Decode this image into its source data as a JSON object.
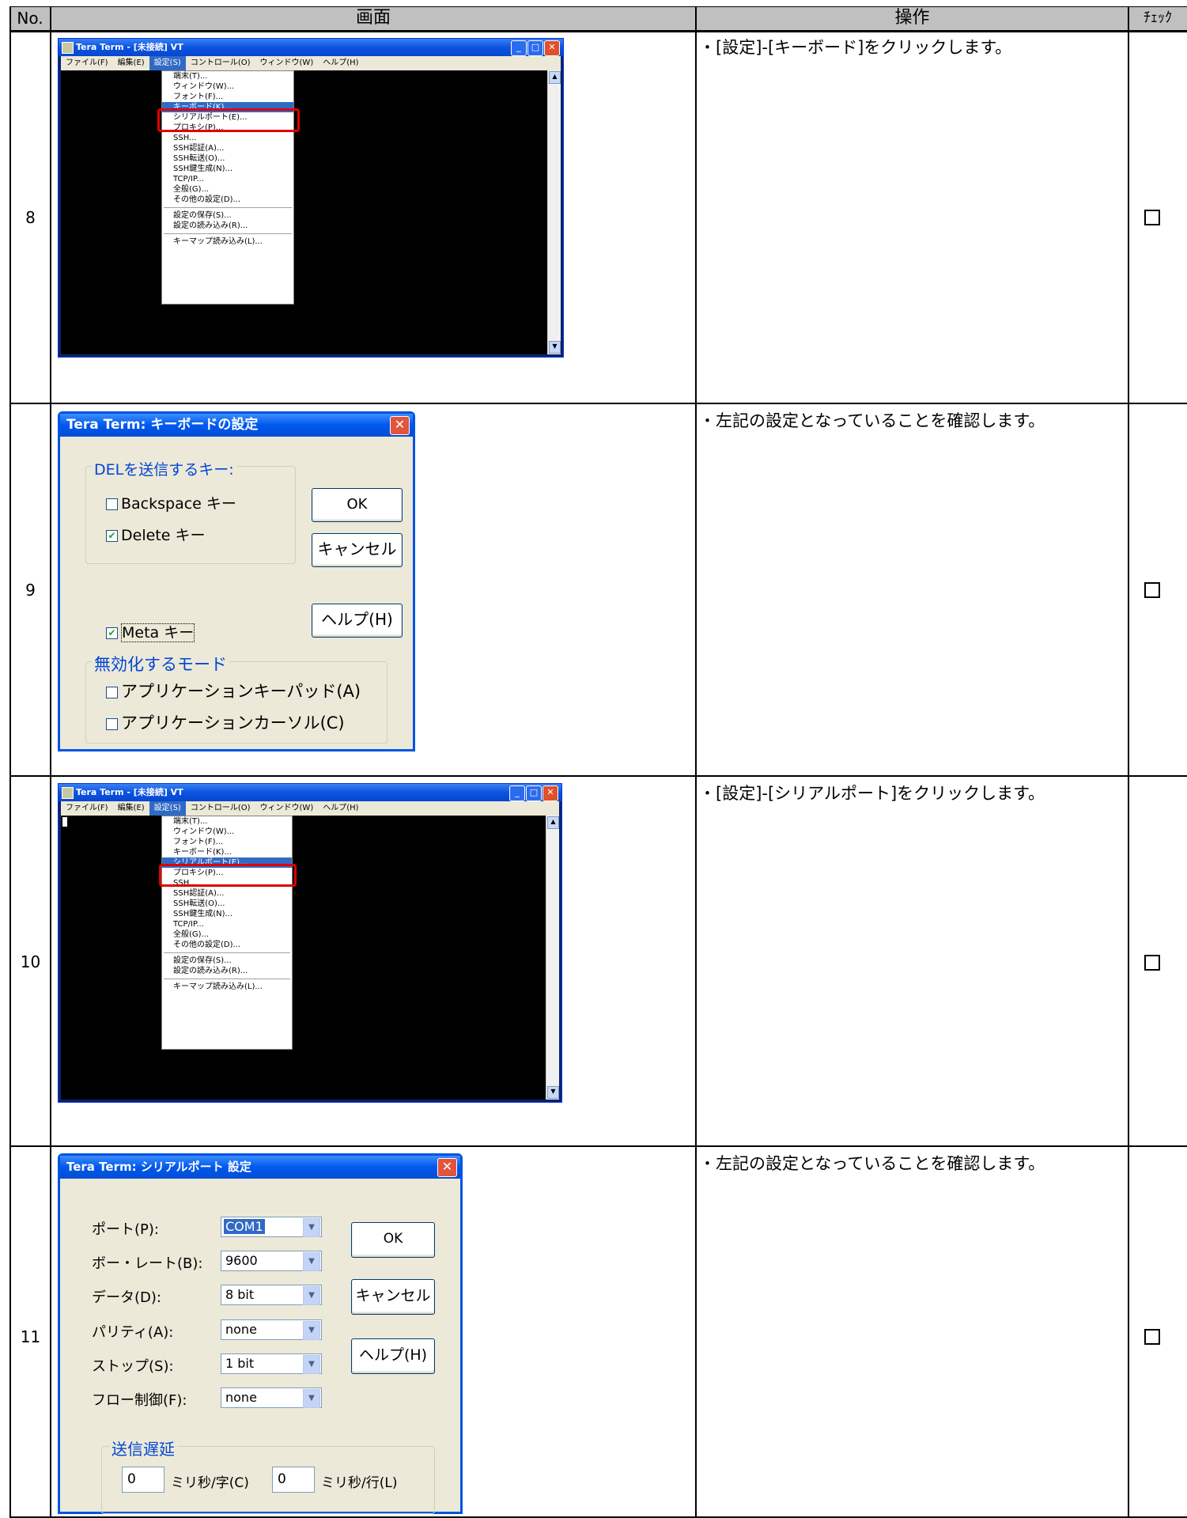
{
  "table": {
    "headers": {
      "no": "No.",
      "screen": "画面",
      "operation": "操作",
      "check": "ﾁｪｯｸ"
    },
    "check_mark": "☐",
    "rows": [
      {
        "no": "8",
        "instruction": "・[設定]-[キーボード]をクリックします。"
      },
      {
        "no": "9",
        "instruction": "・左記の設定となっていることを確認します。"
      },
      {
        "no": "10",
        "instruction": "・[設定]-[シリアルポート]をクリックします。"
      },
      {
        "no": "11",
        "instruction": "・左記の設定となっていることを確認します。"
      }
    ]
  },
  "teraterm_window": {
    "title": "Tera Term - [未接続] VT",
    "menubar": [
      "ファイル(F)",
      "編集(E)",
      "設定(S)",
      "コントロール(O)",
      "ウィンドウ(W)",
      "ヘルプ(H)"
    ],
    "active_menu": "設定(S)",
    "menu_items_a": [
      "端末(T)...",
      "ウィンドウ(W)...",
      "フォント(F)...",
      "キーボード(K)...",
      "シリアルポート(E)...",
      "プロキシ(P)...",
      "SSH...",
      "SSH認証(A)...",
      "SSH転送(O)...",
      "SSH鍵生成(N)...",
      "TCP/IP...",
      "全般(G)...",
      "その他の設定(D)..."
    ],
    "menu_items_b": [
      "設定の保存(S)...",
      "設定の読み込み(R)..."
    ],
    "menu_items_c": [
      "キーマップ読み込み(L)..."
    ],
    "highlight_row8": "キーボード(K)...",
    "highlight_row10": "シリアルポート(E)..."
  },
  "keyboard_dialog": {
    "title": "Tera Term: キーボードの設定",
    "close": "✕",
    "group_del": "DELを送信するキー:",
    "backspace": {
      "label": "Backspace キー",
      "checked": false
    },
    "delete": {
      "label": "Delete キー",
      "checked": true
    },
    "meta": {
      "label": "Meta キー",
      "checked": true
    },
    "group_disable": "無効化するモード",
    "app_keypad": {
      "label": "アプリケーションキーパッド(A)",
      "checked": false
    },
    "app_cursor": {
      "label": "アプリケーションカーソル(C)",
      "checked": false
    },
    "ok": "OK",
    "cancel": "キャンセル",
    "help": "ヘルプ(H)"
  },
  "serial_dialog": {
    "title": "Tera Term: シリアルポート 設定",
    "close": "✕",
    "fields": [
      {
        "label": "ポート(P):",
        "value": "COM1"
      },
      {
        "label": "ボー・レート(B):",
        "value": "9600"
      },
      {
        "label": "データ(D):",
        "value": "8 bit"
      },
      {
        "label": "パリティ(A):",
        "value": "none"
      },
      {
        "label": "ストップ(S):",
        "value": "1 bit"
      },
      {
        "label": "フロー制御(F):",
        "value": "none"
      }
    ],
    "delay_group": "送信遅延",
    "delay_char_value": "0",
    "delay_char_unit": "ミリ秒/字(C)",
    "delay_line_value": "0",
    "delay_line_unit": "ミリ秒/行(L)",
    "ok": "OK",
    "cancel": "キャンセル",
    "help": "ヘルプ(H)"
  }
}
